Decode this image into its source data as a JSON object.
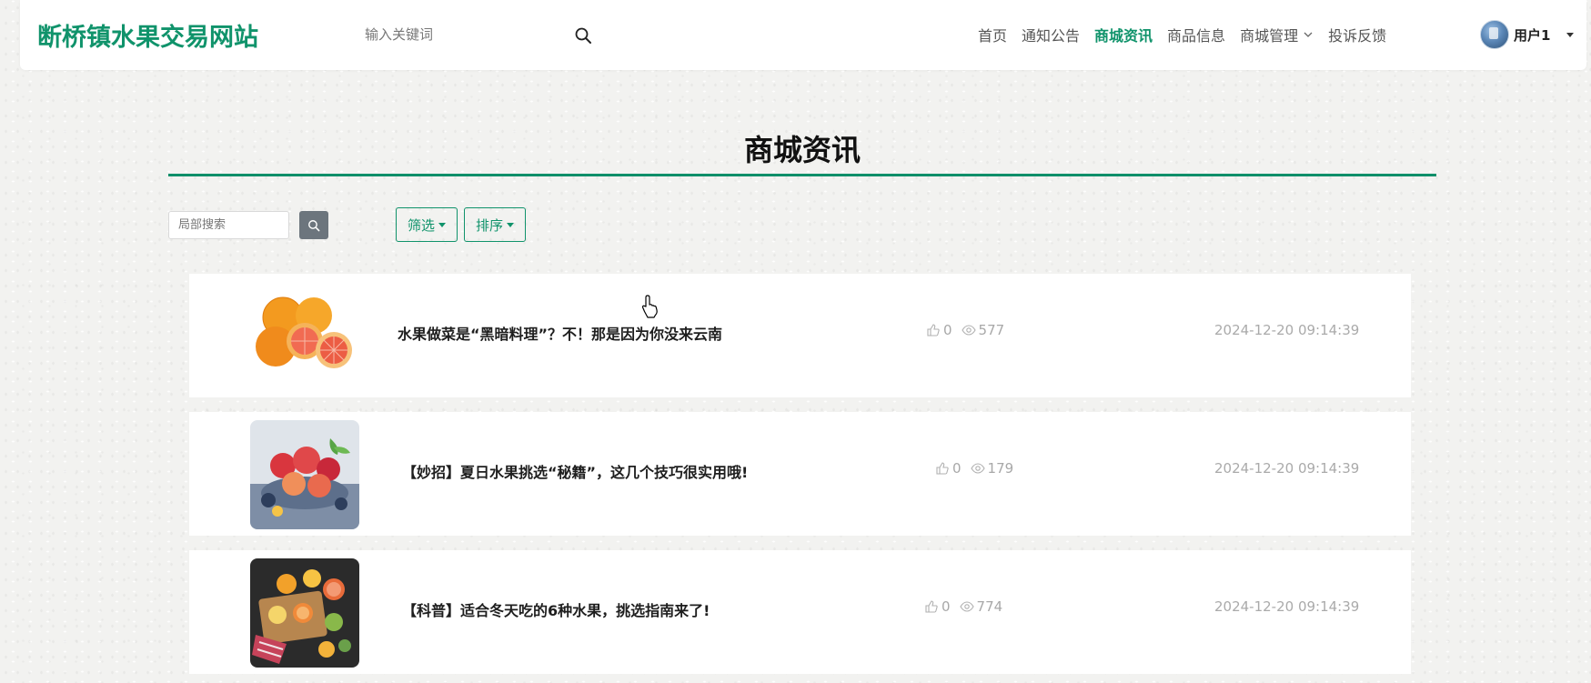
{
  "header": {
    "site_title": "断桥镇水果交易网站",
    "search_placeholder": "输入关键词",
    "nav": [
      {
        "label": "首页",
        "active": false
      },
      {
        "label": "通知公告",
        "active": false
      },
      {
        "label": "商城资讯",
        "active": true
      },
      {
        "label": "商品信息",
        "active": false
      },
      {
        "label": "商城管理",
        "active": false,
        "has_dropdown": true
      },
      {
        "label": "投诉反馈",
        "active": false
      }
    ],
    "user_name": "用户1"
  },
  "page": {
    "title": "商城资讯",
    "local_search_placeholder": "局部搜索",
    "filter_label": "筛选",
    "sort_label": "排序"
  },
  "articles": [
    {
      "title": "水果做菜是“黑暗料理”？不！那是因为你没来云南",
      "likes": "0",
      "views": "577",
      "date": "2024-12-20 09:14:39",
      "image": "grapefruit-oranges"
    },
    {
      "title": "【妙招】夏日水果挑选“秘籍”，这几个技巧很实用哦!",
      "likes": "0",
      "views": "179",
      "date": "2024-12-20 09:14:39",
      "image": "peaches-basket"
    },
    {
      "title": "【科普】适合冬天吃的6种水果，挑选指南来了!",
      "likes": "0",
      "views": "774",
      "date": "2024-12-20 09:14:39",
      "image": "citrus-on-board"
    }
  ],
  "colors": {
    "accent": "#10936b",
    "muted": "#aaaaaa",
    "gray_button": "#6c757d"
  }
}
